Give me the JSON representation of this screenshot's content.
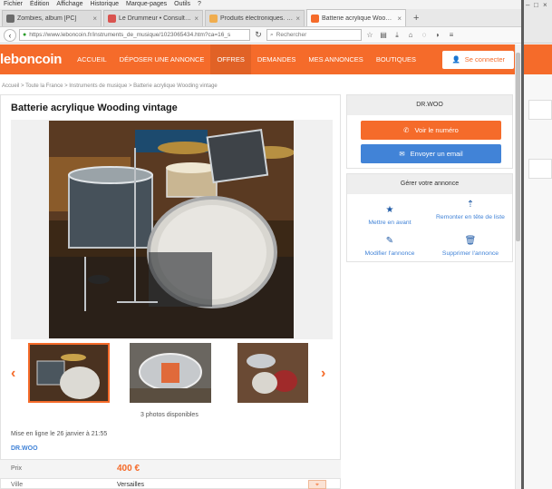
{
  "browser": {
    "menu": [
      "Fichier",
      "Édition",
      "Affichage",
      "Historique",
      "Marque-pages",
      "Outils",
      "?"
    ],
    "tabs": [
      {
        "label": "Zombies, album [PC]",
        "color": "#6b6b6b",
        "active": false
      },
      {
        "label": "Le Drummeur • Consulter le...",
        "color": "#d9534f",
        "active": false
      },
      {
        "label": "Produits électroniques. Vo...",
        "color": "#f0ad4e",
        "active": false
      },
      {
        "label": "Batterie acrylique Wooding...",
        "color": "#f56b2a",
        "active": true
      }
    ],
    "url": "https://www.leboncoin.fr/instruments_de_musique/1023065434.htm?ca=16_s",
    "search_placeholder": "Rechercher",
    "window_controls": [
      "–",
      "□",
      "×"
    ]
  },
  "site": {
    "logo": "leboncoin",
    "nav": [
      "ACCUEIL",
      "DÉPOSER UNE ANNONCE",
      "OFFRES",
      "DEMANDES",
      "MES ANNONCES",
      "BOUTIQUES"
    ],
    "active_nav": "OFFRES",
    "connect_label": "Se connecter"
  },
  "breadcrumb": "Accueil > Toute la France > Instruments de musique > Batterie acrylique Wooding vintage",
  "ad": {
    "title": "Batterie acrylique Wooding vintage",
    "photo_count": "3 photos disponibles",
    "posted": "Mise en ligne le 26 janvier à 21:55",
    "seller": "DR.WOO",
    "price_label": "Prix",
    "price": "400 €",
    "city_label": "Ville",
    "city": "Versailles"
  },
  "seller_panel": {
    "name": "DR.WOO",
    "phone_button": "Voir le numéro",
    "email_button": "Envoyer un email"
  },
  "manage_panel": {
    "title": "Gérer votre annonce",
    "actions": [
      {
        "icon": "star-icon",
        "label": "Mettre en avant"
      },
      {
        "icon": "sort-up-icon",
        "label": "Remonter en tête de liste"
      },
      {
        "icon": "pencil-icon",
        "label": "Modifier l'annonce"
      },
      {
        "icon": "trash-icon",
        "label": "Supprimer l'annonce"
      }
    ]
  },
  "colors": {
    "brand": "#f56b2a",
    "email_blue": "#4183d7",
    "link_blue": "#4183d7"
  }
}
